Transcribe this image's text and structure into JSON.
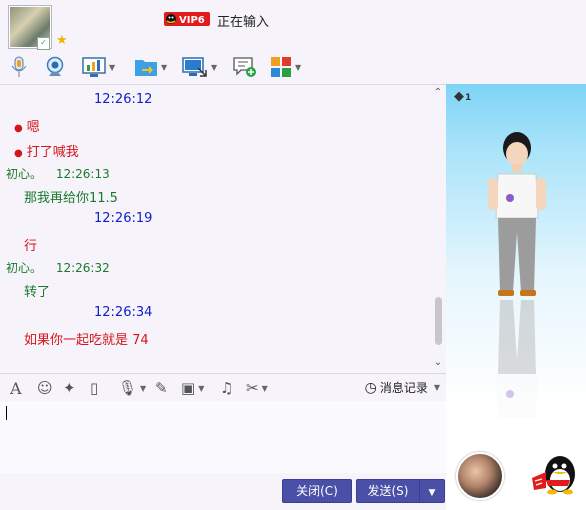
{
  "title": {
    "vip_label": "VIP6",
    "status": "正在输入"
  },
  "window_controls": {
    "minimize": "—",
    "maximize": "□",
    "close": "✕",
    "more": "▽"
  },
  "messages": [
    {
      "kind": "time",
      "color": "blue",
      "text": "12:26:12"
    },
    {
      "kind": "line",
      "color": "red",
      "bullet": true,
      "text": "嗯"
    },
    {
      "kind": "line",
      "color": "red",
      "bullet": true,
      "text": "打了喊我"
    },
    {
      "kind": "sender",
      "color": "green",
      "name": "初心。",
      "time": "12:26:13"
    },
    {
      "kind": "line",
      "color": "green",
      "text": "那我再给你11.5"
    },
    {
      "kind": "time",
      "color": "blue",
      "text": "12:26:19"
    },
    {
      "kind": "line",
      "color": "red",
      "text": "行"
    },
    {
      "kind": "sender",
      "color": "green",
      "name": "初心。",
      "time": "12:26:32"
    },
    {
      "kind": "line",
      "color": "green",
      "text": "转了"
    },
    {
      "kind": "time",
      "color": "blue",
      "text": "12:26:34"
    },
    {
      "kind": "line",
      "color": "red",
      "text": "如果你一起吃就是 74"
    }
  ],
  "input_toolbar": {
    "history_label": "消息记录"
  },
  "buttons": {
    "close": "关闭(C)",
    "send": "发送(S)"
  },
  "side": {
    "diamond_count": "1"
  },
  "colors": {
    "time_blue": "#1020c8",
    "self_red": "#d4151b",
    "peer_green": "#1a7a2c",
    "button_bg": "#4a4fa8"
  }
}
